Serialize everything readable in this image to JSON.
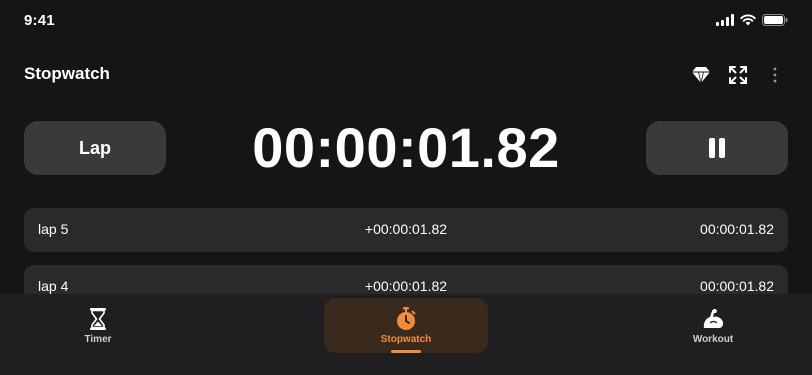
{
  "status_bar": {
    "time": "9:41"
  },
  "header": {
    "title": "Stopwatch"
  },
  "controls": {
    "lap_label": "Lap",
    "display_time": "00:00:01.82"
  },
  "laps": [
    {
      "name": "lap 5",
      "split": "+00:00:01.82",
      "total": "00:00:01.82"
    },
    {
      "name": "lap 4",
      "split": "+00:00:01.82",
      "total": "00:00:01.82"
    }
  ],
  "tabs": [
    {
      "label": "Timer",
      "icon": "hourglass-icon",
      "active": false
    },
    {
      "label": "Stopwatch",
      "icon": "stopwatch-icon",
      "active": true
    },
    {
      "label": "Workout",
      "icon": "flexed-arm-icon",
      "active": false
    }
  ],
  "colors": {
    "background": "#151516",
    "button": "#3a3a3c",
    "row": "#2a2a2c",
    "accent": "#f08c3a"
  }
}
